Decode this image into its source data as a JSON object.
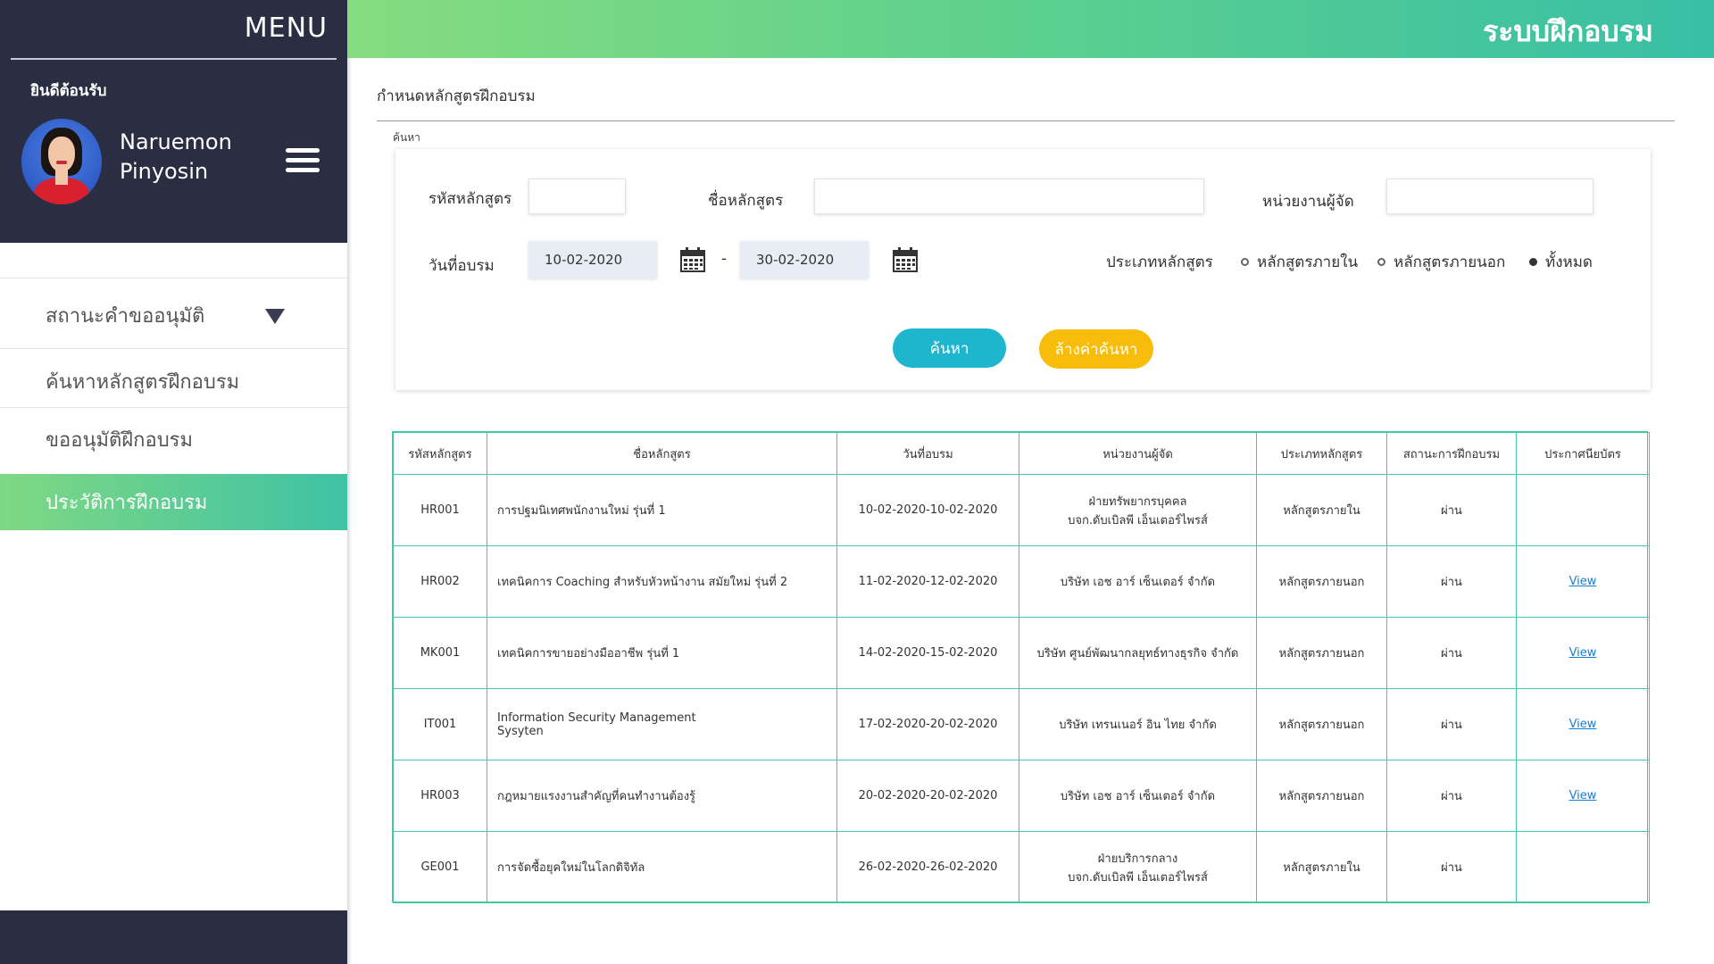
{
  "sidebar": {
    "menu_title": "MENU",
    "welcome": "ยินดีต้อนรับ",
    "user_name_first": "Naruemon",
    "user_name_last": "Pinyosin",
    "items": [
      {
        "label": "สถานะคำขออนุมัติ",
        "has_dropdown": true,
        "active": false
      },
      {
        "label": "ค้นหาหลักสูตรฝึกอบรม",
        "active": false
      },
      {
        "label": "ขออนุมัติฝึกอบรม",
        "active": false
      },
      {
        "label": "ประวัติการฝึกอบรม",
        "active": true
      }
    ]
  },
  "header": {
    "title": "ระบบฝึกอบรม"
  },
  "page": {
    "title": "กำหนดหลักสูตรฝึกอบรม",
    "search_caption": "ค้นหา"
  },
  "search": {
    "course_code_label": "รหัสหลักสูตร",
    "course_code_value": "",
    "course_name_label": "ชื่อหลักสูตร",
    "course_name_value": "",
    "organizer_label": "หน่วยงานผู้จัด",
    "organizer_value": "",
    "date_label": "วันที่อบรม",
    "date_from": "10-02-2020",
    "date_separator": "-",
    "date_to": "30-02-2020",
    "type_label": "ประเภทหลักสูตร",
    "type_options": [
      {
        "label": "หลักสูตรภายใน",
        "selected": false
      },
      {
        "label": "หลักสูตรภายนอก",
        "selected": false
      },
      {
        "label": "ทั้งหมด",
        "selected": true
      }
    ],
    "search_button": "ค้นหา",
    "clear_button": "ล้างค่าค้นหา"
  },
  "table": {
    "headers": [
      "รหัสหลักสูตร",
      "ชื่อหลักสูตร",
      "วันที่อบรม",
      "หน่วยงานผู้จัด",
      "ประเภทหลักสูตร",
      "สถานะการฝึกอบรม",
      "ประกาศนียบัตร"
    ],
    "rows": [
      {
        "code": "HR001",
        "name": "การปฐมนิเทศพนักงานใหม่ รุ่นที่ 1",
        "name2": "",
        "dates": "10-02-2020-10-02-2020",
        "org": "ฝ่ายทรัพยากรบุคคล",
        "org2": "บจก.ดับเบิลพี เอ็นเตอร์ไพรส์",
        "type": "หลักสูตรภายใน",
        "status": "ผ่าน",
        "cert": ""
      },
      {
        "code": "HR002",
        "name": "เทคนิคการ Coaching สำหรับหัวหน้างาน สมัยใหม่ รุ่นที่ 2",
        "name2": "",
        "dates": "11-02-2020-12-02-2020",
        "org": "บริษัท เอช อาร์ เซ็นเตอร์ จำกัด",
        "org2": "",
        "type": "หลักสูตรภายนอก",
        "status": "ผ่าน",
        "cert": "View"
      },
      {
        "code": "MK001",
        "name": "เทคนิคการขายอย่างมืออาชีพ รุ่นที่ 1",
        "name2": "",
        "dates": "14-02-2020-15-02-2020",
        "org": "บริษัท ศูนย์พัฒนากลยุทธ์ทางธุรกิจ จำกัด",
        "org2": "",
        "type": "หลักสูตรภายนอก",
        "status": "ผ่าน",
        "cert": "View"
      },
      {
        "code": "IT001",
        "name": "Information Security Management",
        "name2": "Sysyten",
        "dates": "17-02-2020-20-02-2020",
        "org": "บริษัท เทรนเนอร์ อิน ไทย จำกัด",
        "org2": "",
        "type": "หลักสูตรภายนอก",
        "status": "ผ่าน",
        "cert": "View"
      },
      {
        "code": "HR003",
        "name": "กฎหมายแรงงานสำคัญที่คนทำงานต้องรู้",
        "name2": "",
        "dates": "20-02-2020-20-02-2020",
        "org": "บริษัท เอช อาร์ เซ็นเตอร์ จำกัด",
        "org2": "",
        "type": "หลักสูตรภายนอก",
        "status": "ผ่าน",
        "cert": "View"
      },
      {
        "code": "GE001",
        "name": "การจัดซื้อยุคใหม่ในโลกดิจิทัล",
        "name2": "",
        "dates": "26-02-2020-26-02-2020",
        "org": "ฝ่ายบริการกลาง",
        "org2": "บจก.ดับเบิลพี เอ็นเตอร์ไพรส์",
        "type": "หลักสูตรภายใน",
        "status": "ผ่าน",
        "cert": ""
      }
    ]
  },
  "colors": {
    "sidebar_dark": "#2b2d42",
    "header_gradient_start": "#86dc80",
    "header_gradient_end": "#38bfa5",
    "search_button": "#1eb5cf",
    "clear_button": "#f8bd0a",
    "table_border": "#44c6a8",
    "link": "#1a7fd6"
  },
  "icons": {
    "dropdown": "triangle-down-icon",
    "menu": "hamburger-icon",
    "calendar": "calendar-icon"
  }
}
